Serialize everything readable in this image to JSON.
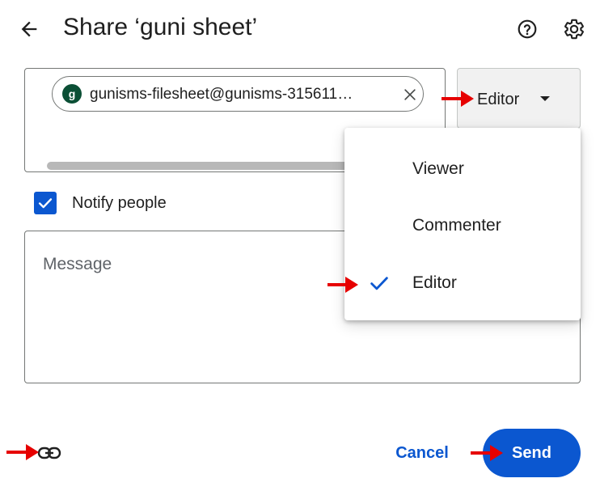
{
  "header": {
    "title": "Share ‘guni sheet’",
    "back_icon": "arrow-back-icon",
    "help_icon": "help-icon",
    "settings_icon": "gear-icon"
  },
  "recipient": {
    "avatar_letter": "g",
    "email": "gunisms-filesheet@gunisms-315611…",
    "remove_icon": "close-icon",
    "avatar_color": "#0b4f35"
  },
  "role_button": {
    "label": "Editor",
    "caret_icon": "caret-down-icon"
  },
  "notify": {
    "checked": true,
    "label": "Notify people"
  },
  "message": {
    "placeholder": "Message"
  },
  "role_menu": {
    "items": [
      {
        "label": "Viewer",
        "selected": false
      },
      {
        "label": "Commenter",
        "selected": false
      },
      {
        "label": "Editor",
        "selected": true
      }
    ],
    "check_icon": "check-icon"
  },
  "footer": {
    "link_icon": "link-icon",
    "cancel_label": "Cancel",
    "send_label": "Send"
  },
  "colors": {
    "accent": "#0b57d0",
    "annotation_arrow": "#e60000"
  }
}
